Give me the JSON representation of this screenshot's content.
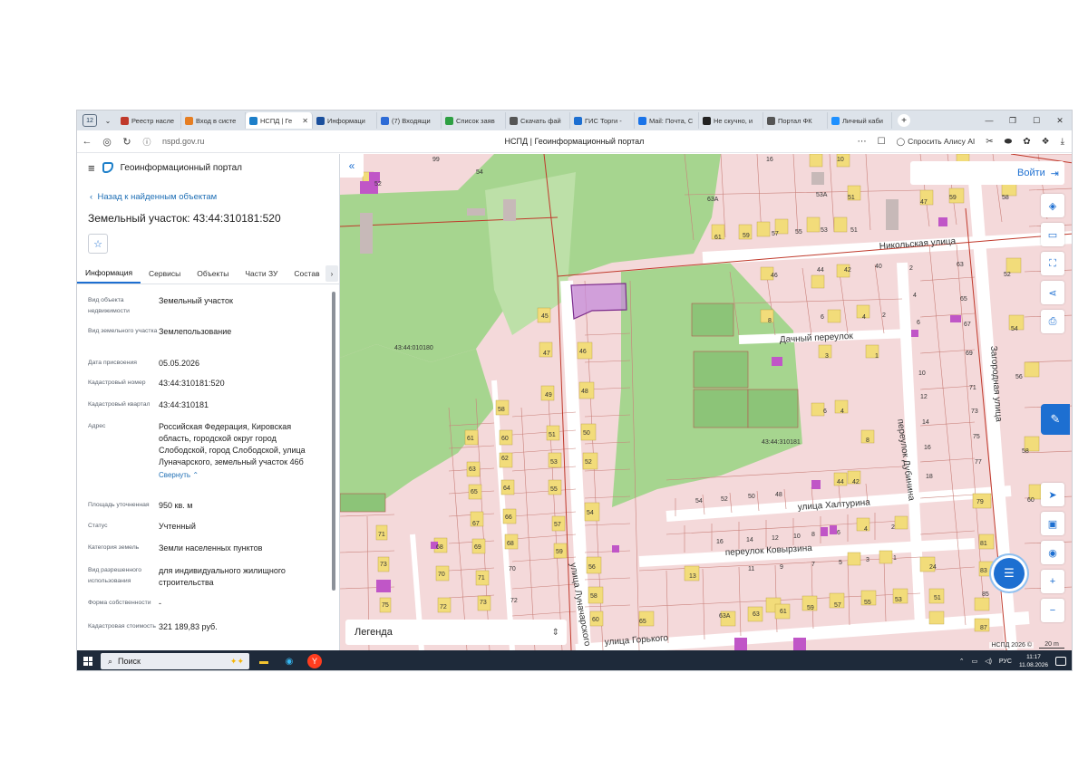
{
  "browser": {
    "tab_count": "12",
    "tabs": [
      {
        "label": "Реестр насле",
        "color": "#c0392b"
      },
      {
        "label": "Вход в систе",
        "color": "#e67e22"
      },
      {
        "label": "НСПД | Ге",
        "color": "#1d7fc9",
        "active": true
      },
      {
        "label": "Информаци",
        "color": "#1a4f9c"
      },
      {
        "label": "(7) Входящи",
        "color": "#2d6bd6"
      },
      {
        "label": "Список заяв",
        "color": "#2ea043"
      },
      {
        "label": "Скачать фай",
        "color": "#555555"
      },
      {
        "label": "ГИС Торги -",
        "color": "#1d6fd1"
      },
      {
        "label": "Mail: Почта, С",
        "color": "#1a73e8"
      },
      {
        "label": "Не скучно, и",
        "color": "#222222"
      },
      {
        "label": "Портал ФК",
        "color": "#555555"
      },
      {
        "label": "Личный каби",
        "color": "#1e90ff"
      }
    ],
    "url": "nspd.gov.ru",
    "page_title": "НСПД | Геоинформационный портал",
    "alice_label": "Спросить Алису AI"
  },
  "panel": {
    "portal_title": "Геоинформационный портал",
    "back_label": "Назад к найденным объектам",
    "object_title": "Земельный участок: 43:44:310181:520",
    "tabs": [
      "Информация",
      "Сервисы",
      "Объекты",
      "Части ЗУ",
      "Состав"
    ],
    "properties": [
      {
        "label": "Вид объекта недвижимости",
        "value": "Земельный участок"
      },
      {
        "label": "Вид земельного участка",
        "value": "Землепользование"
      },
      {
        "label": "Дата присвоения",
        "value": "05.05.2026"
      },
      {
        "label": "Кадастровый номер",
        "value": "43:44:310181:520"
      },
      {
        "label": "Кадастровый квартал",
        "value": "43:44:310181"
      },
      {
        "label": "Адрес",
        "value": "Российская Федерация, Кировская область, городской округ город Слободской, город Слободской, улица Луначарского, земельный участок 46б"
      },
      {
        "label": "Площадь уточненная",
        "value": "950 кв. м"
      },
      {
        "label": "Статус",
        "value": "Учтенный"
      },
      {
        "label": "Категория земель",
        "value": "Земли населенных пунктов"
      },
      {
        "label": "Вид разрешенного использования",
        "value": "для индивидуального жилищного строительства"
      },
      {
        "label": "Форма собственности",
        "value": "-"
      },
      {
        "label": "Кадастровая стоимость",
        "value": "321 189,83 руб."
      }
    ],
    "collapse_label": "Свернуть"
  },
  "map": {
    "login_label": "Войти",
    "legend_label": "Легенда",
    "attribution": "НСПД 2026 ©",
    "scale_label": "20 m",
    "streets": {
      "nikolskaya": "Никольская улица",
      "dachny": "Дачный переулок",
      "khalturina": "улица Халтурина",
      "kovyrzina": "переулок Ковырзина",
      "gorkogo": "улица Горького",
      "lunacharskogo": "улица Луначарского",
      "dubinina": "переулок Дубинина",
      "zagorodnaya": "Загородная улица"
    },
    "quarters": [
      "43:44:010180",
      "43:44:310181"
    ],
    "colors": {
      "parcel": "#f2c9cc",
      "forest": "#9fd28a",
      "building": "#f2dc7a",
      "selected": "#c68bd9",
      "accent": "#1d6fd1"
    }
  },
  "taskbar": {
    "search_label": "Поиск",
    "lang": "РУС",
    "time": "11:17",
    "date": "11.08.2026"
  }
}
